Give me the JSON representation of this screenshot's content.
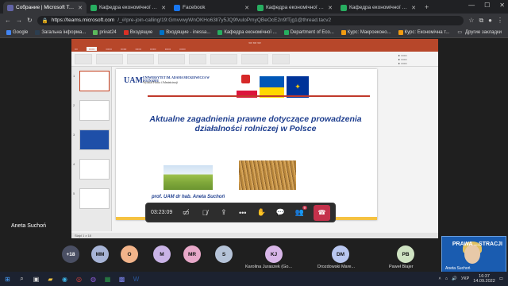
{
  "browser": {
    "tabs": [
      {
        "title": "Собрание | Microsoft Teams",
        "color": "#6264a7",
        "active": true
      },
      {
        "title": "Кафедра економічної теорії",
        "color": "#27ae60",
        "active": false
      },
      {
        "title": "Facebook",
        "color": "#1877f2",
        "active": false
      },
      {
        "title": "Кафедра економічної теорії",
        "color": "#27ae60",
        "active": false
      },
      {
        "title": "Кафедра економічної теорії",
        "color": "#27ae60",
        "active": false
      }
    ],
    "url_host": "https://teams.microsoft.com",
    "url_rest": "/_#/pre-join-calling/19:GmvvwyWnOKHo63ll7y5JQ9fvuloPmyQBeOcE2n9fTjg1@thread.tacv2",
    "bookmarks": [
      {
        "label": "Google",
        "color": "#4285f4"
      },
      {
        "label": "Загальна інформа...",
        "color": "#2c3e50"
      },
      {
        "label": "privat24",
        "color": "#5cb85c"
      },
      {
        "label": "Входящие",
        "color": "#d93025"
      },
      {
        "label": "Входящие - inessa...",
        "color": "#0072c6"
      },
      {
        "label": "Кафедра економічної ...",
        "color": "#27ae60"
      },
      {
        "label": "Department of Eco...",
        "color": "#27ae60"
      },
      {
        "label": "Курс: Макроеконо...",
        "color": "#f39c12"
      },
      {
        "label": "Курс: Економічна т...",
        "color": "#f39c12"
      }
    ],
    "bookmarks_other": "Другие закладки"
  },
  "slide": {
    "univ": "UNIWERSYTET IM. ADAMA MICKIEWICZA W POZNANIU",
    "univ_sub": "Wydział Prawa i Administracji",
    "logo": "UAM",
    "title": "Aktualne zagadnienia prawne dotyczące prowadzenia działalności rolniczej w Polsce",
    "author": "prof. UAM  dr hab. Aneta Suchoń",
    "zaklad": "Zakład Prawa Rolnego, Żywnościowego i Ochrony Środowiska UAM",
    "status": "Slajd 1 z 18"
  },
  "call": {
    "timer": "03:23:09",
    "participants_badge": "9",
    "speaker_name": "Aneta Suchoń"
  },
  "participants": [
    {
      "initials": "+18",
      "color": "#4a4f63",
      "name": ""
    },
    {
      "initials": "MM",
      "color": "#a7b4d6",
      "name": ""
    },
    {
      "initials": "O",
      "color": "#f2b48a",
      "name": ""
    },
    {
      "initials": "M",
      "color": "#c9b3e6",
      "name": ""
    },
    {
      "initials": "MR",
      "color": "#e8a8c9",
      "name": ""
    },
    {
      "initials": "S",
      "color": "#b5c3d8",
      "name": ""
    },
    {
      "initials": "KJ",
      "color": "#d8b6e8",
      "name": "Karolina Juraszek (Go..."
    },
    {
      "initials": "DM",
      "color": "#b9c7f0",
      "name": "Drozdowski Mare..."
    },
    {
      "initials": "PB",
      "color": "#cfe3c2",
      "name": "Paweł Blajer"
    }
  ],
  "selfview": {
    "label": "PRAWA ...STRACJI",
    "name": "Aneta Suchoń"
  },
  "taskbar": {
    "lang": "УКР",
    "time": "16:37",
    "date": "14.09.2022"
  }
}
